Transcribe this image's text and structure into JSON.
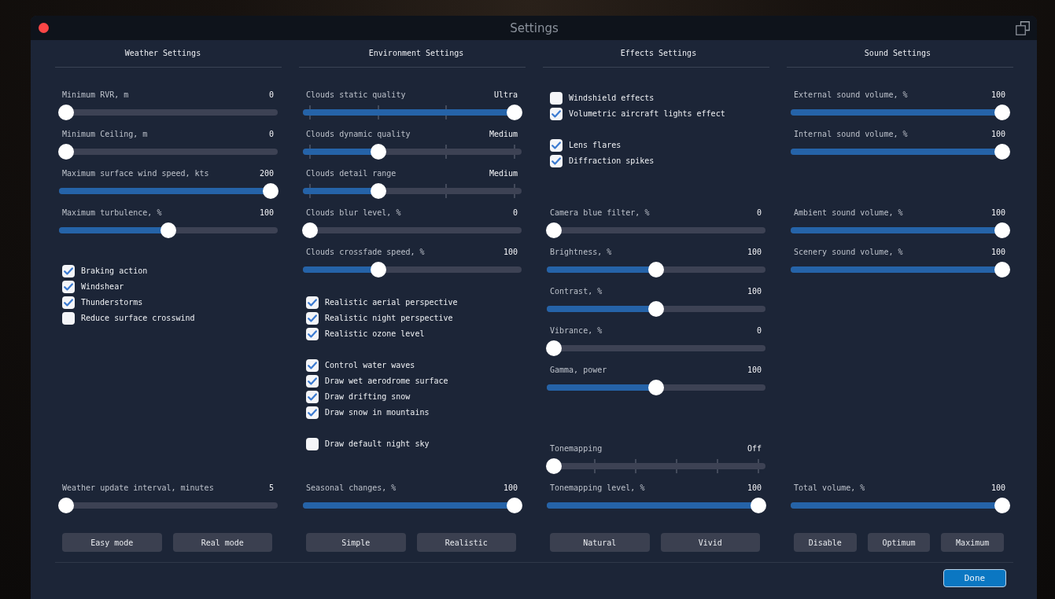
{
  "window": {
    "title": "Settings"
  },
  "columns": [
    {
      "heading": "Weather Settings",
      "groups": [
        {
          "items": [
            {
              "kind": "slider",
              "label": "Minimum RVR, m",
              "value": "0",
              "level": 0
            },
            {
              "kind": "slider",
              "label": "Minimum Ceiling, m",
              "value": "0",
              "level": 0
            },
            {
              "kind": "slider",
              "label": "Maximum surface wind speed, kts",
              "value": "200",
              "level": 1
            },
            {
              "kind": "slider",
              "label": "Maximum turbulence, %",
              "value": "100",
              "level": 0.5
            }
          ]
        },
        {
          "items": [
            {
              "kind": "checkbox",
              "label": "Braking action",
              "checked": true
            },
            {
              "kind": "checkbox",
              "label": "Windshear",
              "checked": true
            },
            {
              "kind": "checkbox",
              "label": "Thunderstorms",
              "checked": true
            },
            {
              "kind": "checkbox",
              "label": "Reduce surface crosswind",
              "checked": false
            }
          ]
        }
      ],
      "bottom": {
        "items": [
          {
            "kind": "slider",
            "label": "Weather update interval, minutes",
            "value": "5",
            "level": 0
          }
        ],
        "buttons": [
          "Easy mode",
          "Real mode"
        ]
      }
    },
    {
      "heading": "Environment Settings",
      "groups": [
        {
          "items": [
            {
              "kind": "four-notch",
              "label": "Clouds static quality",
              "value": "Ultra",
              "level": 1
            },
            {
              "kind": "four-notch",
              "label": "Clouds dynamic quality",
              "value": "Medium",
              "level": 0.333
            },
            {
              "kind": "four-notch",
              "label": "Clouds detail range",
              "value": "Medium",
              "level": 0.333
            },
            {
              "kind": "slider",
              "label": "Clouds blur level, %",
              "value": "0",
              "level": 0
            },
            {
              "kind": "slider",
              "label": "Clouds crossfade speed, %",
              "value": "100",
              "level": 0.333
            }
          ]
        },
        {
          "items": [
            {
              "kind": "checkbox",
              "label": "Realistic aerial perspective",
              "checked": true
            },
            {
              "kind": "checkbox",
              "label": "Realistic night perspective",
              "checked": true
            },
            {
              "kind": "checkbox",
              "label": "Realistic ozone level",
              "checked": true
            }
          ]
        },
        {
          "items": [
            {
              "kind": "checkbox",
              "label": "Control water waves",
              "checked": true
            },
            {
              "kind": "checkbox",
              "label": "Draw wet aerodrome surface",
              "checked": true
            },
            {
              "kind": "checkbox",
              "label": "Draw drifting snow",
              "checked": true
            },
            {
              "kind": "checkbox",
              "label": "Draw snow in mountains",
              "checked": true
            }
          ]
        },
        {
          "items": [
            {
              "kind": "checkbox",
              "label": "Draw default night sky",
              "checked": false
            }
          ]
        }
      ],
      "bottom": {
        "items": [
          {
            "kind": "slider",
            "label": "Seasonal changes, %",
            "value": "100",
            "level": 1
          }
        ],
        "buttons": [
          "Simple",
          "Realistic"
        ]
      }
    },
    {
      "heading": "Effects Settings",
      "groups": [
        {
          "items": [
            {
              "kind": "checkbox",
              "label": "Windshield effects",
              "checked": false
            },
            {
              "kind": "checkbox",
              "label": "Volumetric aircraft lights effect",
              "checked": true
            }
          ]
        },
        {
          "items": [
            {
              "kind": "checkbox",
              "label": "Lens flares",
              "checked": true
            },
            {
              "kind": "checkbox",
              "label": "Diffraction spikes",
              "checked": true
            }
          ]
        },
        {
          "items": [
            {
              "kind": "slider",
              "label": "Camera blue filter, %",
              "value": "0",
              "level": 0
            },
            {
              "kind": "slider",
              "label": "Brightness, %",
              "value": "100",
              "level": 0.5
            },
            {
              "kind": "slider",
              "label": "Contrast, %",
              "value": "100",
              "level": 0.5
            },
            {
              "kind": "slider",
              "label": "Vibrance, %",
              "value": "0",
              "level": 0
            },
            {
              "kind": "slider",
              "label": "Gamma, power",
              "value": "100",
              "level": 0.5
            }
          ]
        },
        {
          "items": [
            {
              "kind": "six-notch",
              "label": "Tonemapping",
              "value": "Off",
              "level": 0
            }
          ]
        }
      ],
      "bottom": {
        "items": [
          {
            "kind": "slider",
            "label": "Tonemapping level, %",
            "value": "100",
            "level": 1
          }
        ],
        "buttons": [
          "Natural",
          "Vivid"
        ]
      }
    },
    {
      "heading": "Sound Settings",
      "groups": [
        {
          "items": [
            {
              "kind": "slider",
              "label": "External sound volume, %",
              "value": "100",
              "level": 1
            },
            {
              "kind": "slider",
              "label": "Internal sound volume, %",
              "value": "100",
              "level": 1
            }
          ]
        },
        {
          "items": [
            {
              "kind": "slider",
              "label": "Ambient sound volume, %",
              "value": "100",
              "level": 1
            },
            {
              "kind": "slider",
              "label": "Scenery sound volume, %",
              "value": "100",
              "level": 1
            }
          ]
        }
      ],
      "bottom": {
        "items": [
          {
            "kind": "slider",
            "label": "Total volume, %",
            "value": "100",
            "level": 1
          }
        ],
        "buttons": [
          "Disable",
          "Optimum",
          "Maximum"
        ]
      }
    }
  ],
  "done_button": "Done"
}
